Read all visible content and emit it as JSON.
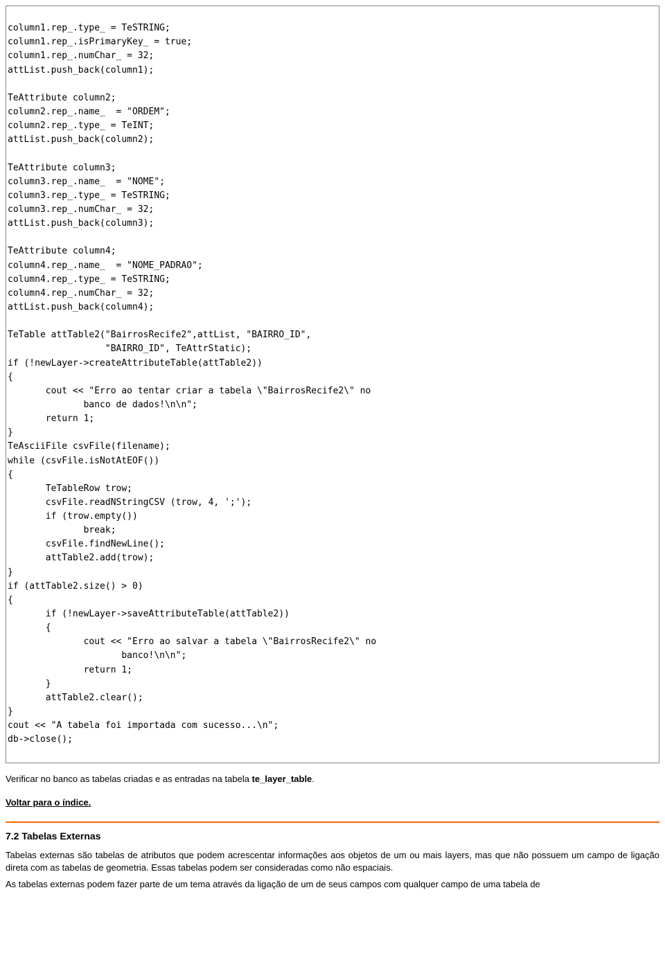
{
  "code": "column1.rep_.type_ = TeSTRING;\ncolumn1.rep_.isPrimaryKey_ = true;\ncolumn1.rep_.numChar_ = 32;\nattList.push_back(column1);\n\nTeAttribute column2;\ncolumn2.rep_.name_  = \"ORDEM\";\ncolumn2.rep_.type_ = TeINT;\nattList.push_back(column2);\n\nTeAttribute column3;\ncolumn3.rep_.name_  = \"NOME\";\ncolumn3.rep_.type_ = TeSTRING;\ncolumn3.rep_.numChar_ = 32;\nattList.push_back(column3);\n\nTeAttribute column4;\ncolumn4.rep_.name_  = \"NOME_PADRAO\";\ncolumn4.rep_.type_ = TeSTRING;\ncolumn4.rep_.numChar_ = 32;\nattList.push_back(column4);\n\nTeTable attTable2(\"BairrosRecife2\",attList, \"BAIRRO_ID\",\n                  \"BAIRRO_ID\", TeAttrStatic);\nif (!newLayer->createAttributeTable(attTable2))\n{\n       cout << \"Erro ao tentar criar a tabela \\\"BairrosRecife2\\\" no\n              banco de dados!\\n\\n\";\n       return 1;\n}\nTeAsciiFile csvFile(filename);\nwhile (csvFile.isNotAtEOF())\n{\n       TeTableRow trow;\n       csvFile.readNStringCSV (trow, 4, ';');\n       if (trow.empty())\n              break;\n       csvFile.findNewLine();\n       attTable2.add(trow);\n}\nif (attTable2.size() > 0)\n{\n       if (!newLayer->saveAttributeTable(attTable2))\n       {\n              cout << \"Erro ao salvar a tabela \\\"BairrosRecife2\\\" no\n                     banco!\\n\\n\";\n              return 1;\n       }\n       attTable2.clear();\n}\ncout << \"A tabela foi importada com sucesso...\\n\";\ndb->close();",
  "para1_pre": "Verificar no banco as tabelas criadas e as entradas na tabela ",
  "para1_bold": "te_layer_table",
  "para1_post": ".",
  "back_link": "Voltar para o índice.",
  "section_title": "7.2 Tabelas Externas",
  "para2": "Tabelas externas são tabelas de atributos que podem acrescentar informações aos objetos de um ou mais layers, mas que não possuem um campo de ligação direta com as tabelas de geometria. Essas tabelas podem ser consideradas como não espaciais.",
  "para3": "As tabelas externas podem fazer parte de um tema através da ligação de um de seus campos com qualquer campo de uma tabela de"
}
